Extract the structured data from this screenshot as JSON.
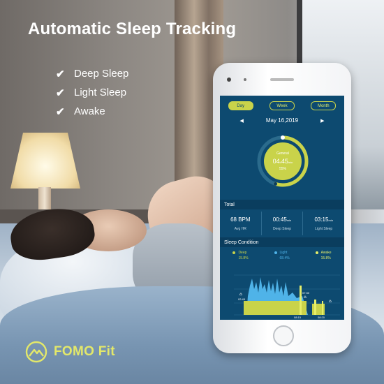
{
  "headline": "Automatic Sleep Tracking",
  "features": [
    "Deep Sleep",
    "Light Sleep",
    "Awake"
  ],
  "brand": {
    "name": "FOMO Fit",
    "color": "#e3e86a"
  },
  "app": {
    "tabs": [
      {
        "label": "Day",
        "active": true
      },
      {
        "label": "Week",
        "active": false
      },
      {
        "label": "Month",
        "active": false
      }
    ],
    "date": "May 16,2019",
    "gauge": {
      "label": "General",
      "hours": "04",
      "hours_unit": "h",
      "minutes": "45",
      "minutes_unit": "min",
      "percent": "55%",
      "progress": 0.55
    },
    "total": {
      "title": "Total",
      "stats": [
        {
          "value": "68 BPM",
          "unit": "",
          "label": "Avg HR"
        },
        {
          "value": "00:45",
          "unit": "min",
          "label": "Deep Sleep"
        },
        {
          "value": "03:15",
          "unit": "min",
          "label": "Light Sleep"
        }
      ]
    },
    "condition": {
      "title": "Sleep Condition",
      "legend": [
        {
          "name": "Deep",
          "pct": "15.8%",
          "color": "#c9d34a"
        },
        {
          "name": "Light",
          "pct": "68.4%",
          "color": "#4fb3e8"
        },
        {
          "name": "Awake",
          "pct": "15.8%",
          "color": "#e6ee6a"
        }
      ],
      "times": [
        "02:45",
        "07:30",
        "08:15",
        "08:20"
      ]
    },
    "colors": {
      "screen_bg": "#0d4a70",
      "accent": "#c9d34a",
      "light": "#4fb3e8"
    }
  }
}
